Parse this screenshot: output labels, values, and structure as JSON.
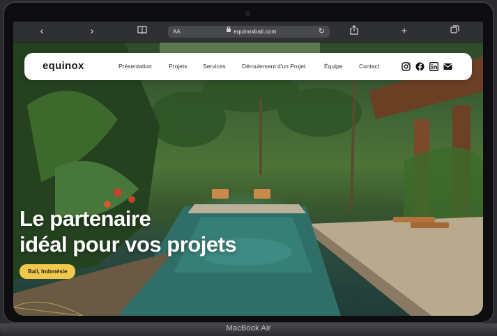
{
  "device": {
    "label": "MacBook Air"
  },
  "browser": {
    "text_size_label": "AA",
    "url": "equinoxbali.com"
  },
  "site": {
    "logo": "equinox",
    "nav": [
      {
        "label": "Présentation"
      },
      {
        "label": "Projets"
      },
      {
        "label": "Services"
      },
      {
        "label": "Déroulement d'un Projet"
      },
      {
        "label": "Équipe"
      },
      {
        "label": "Contact"
      }
    ],
    "social_icons": [
      "instagram-icon",
      "facebook-icon",
      "linkedin-icon",
      "mail-icon"
    ]
  },
  "hero": {
    "title_line1": "Le partenaire",
    "title_line2": "idéal pour vos projets",
    "location_badge": "Bali, Indonésie"
  },
  "colors": {
    "badge": "#f2c94c",
    "nav_bg": "#ffffff",
    "browser_chrome": "#2f3033"
  }
}
